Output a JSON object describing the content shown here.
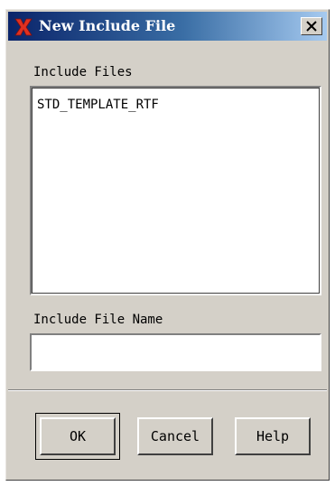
{
  "window": {
    "title": "New Include File",
    "close_icon": "close-icon",
    "app_icon": "x-app-icon",
    "title_color": "#ffffff",
    "titlebar_color": "#0a246a"
  },
  "include_files": {
    "label": "Include Files",
    "items": [
      "STD_TEMPLATE_RTF"
    ]
  },
  "include_file_name": {
    "label": "Include File Name",
    "value": "",
    "placeholder": ""
  },
  "buttons": {
    "ok": "OK",
    "cancel": "Cancel",
    "help": "Help"
  }
}
